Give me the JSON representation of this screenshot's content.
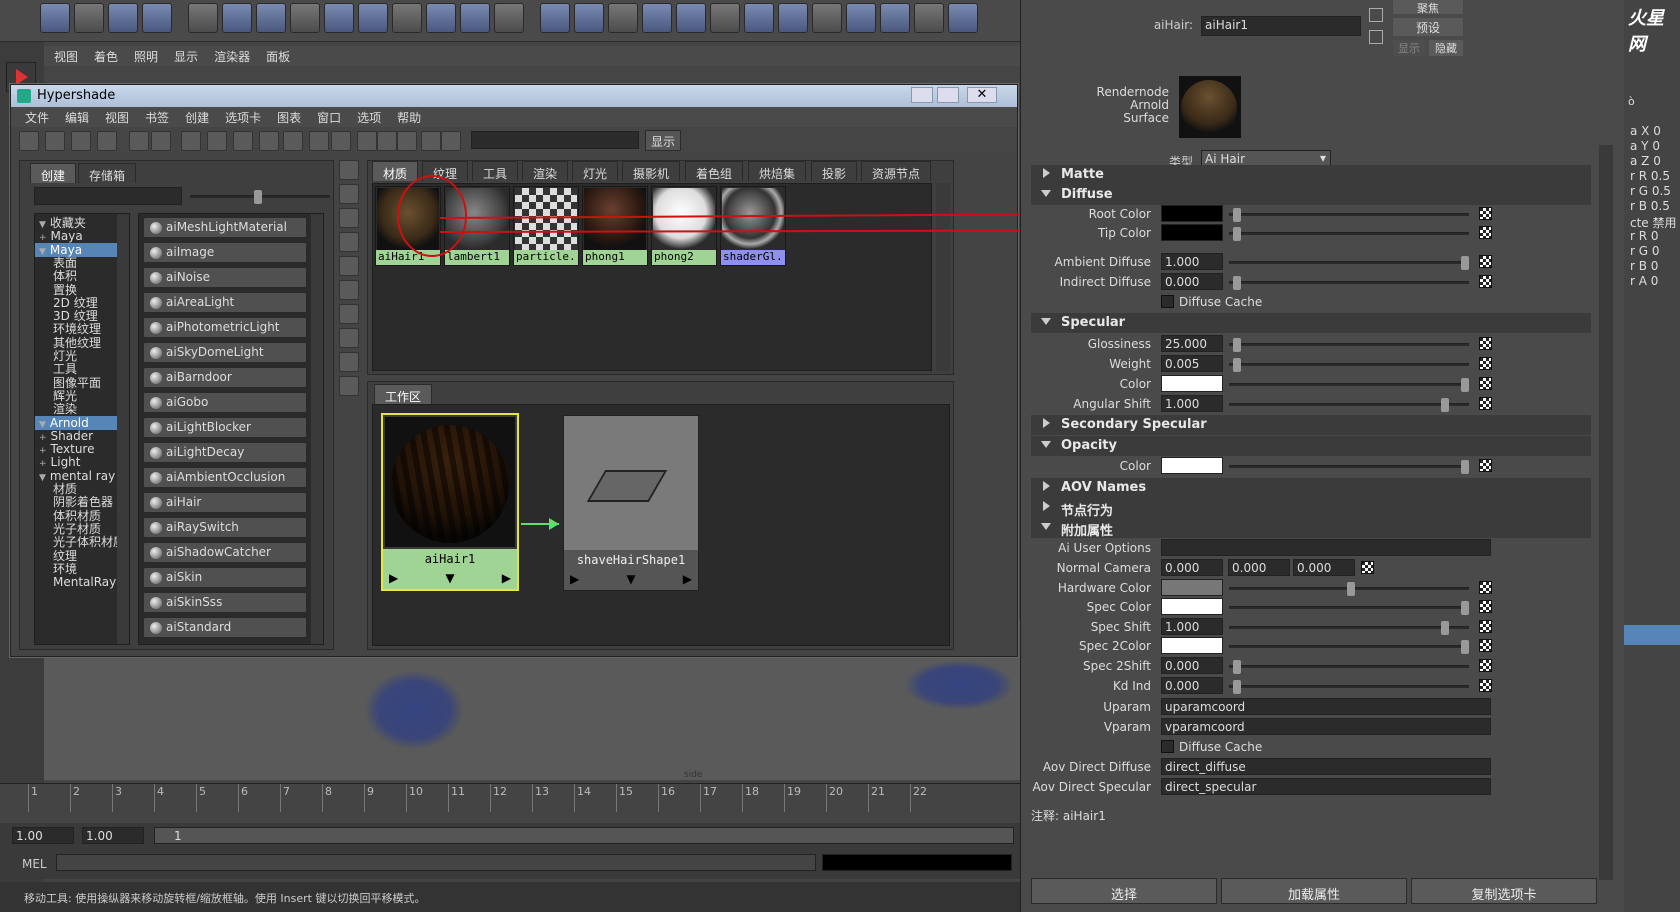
{
  "viewport_menu": [
    "视图",
    "着色",
    "照明",
    "显示",
    "渲染器",
    "面板"
  ],
  "hypershade": {
    "title": "Hypershade",
    "menu": [
      "文件",
      "编辑",
      "视图",
      "书签",
      "创建",
      "选项卡",
      "图表",
      "窗口",
      "选项",
      "帮助"
    ],
    "show_button": "显示",
    "left_tabs": [
      "创建",
      "存储箱"
    ],
    "tree": [
      {
        "label": "收藏夹",
        "indent": 0,
        "exp": "▼"
      },
      {
        "label": "Maya",
        "indent": 1,
        "exp": "+"
      },
      {
        "label": "Maya",
        "indent": 0,
        "exp": "▼",
        "sel": true
      },
      {
        "label": "表面",
        "indent": 2
      },
      {
        "label": "体积",
        "indent": 2
      },
      {
        "label": "置换",
        "indent": 2
      },
      {
        "label": "2D 纹理",
        "indent": 2
      },
      {
        "label": "3D 纹理",
        "indent": 2
      },
      {
        "label": "环境纹理",
        "indent": 2
      },
      {
        "label": "其他纹理",
        "indent": 2
      },
      {
        "label": "灯光",
        "indent": 2
      },
      {
        "label": "工具",
        "indent": 2
      },
      {
        "label": "图像平面",
        "indent": 2
      },
      {
        "label": "辉光",
        "indent": 2
      },
      {
        "label": "渲染",
        "indent": 2
      },
      {
        "label": "Arnold",
        "indent": 0,
        "exp": "▼",
        "sel": true
      },
      {
        "label": "Shader",
        "indent": 1,
        "exp": "+"
      },
      {
        "label": "Texture",
        "indent": 1,
        "exp": "+"
      },
      {
        "label": "Light",
        "indent": 1,
        "exp": "+"
      },
      {
        "label": "mental ray",
        "indent": 0,
        "exp": "▼"
      },
      {
        "label": "材质",
        "indent": 2
      },
      {
        "label": "阴影着色器",
        "indent": 2
      },
      {
        "label": "体积材质",
        "indent": 2
      },
      {
        "label": "光子材质",
        "indent": 2
      },
      {
        "label": "光子体积材质",
        "indent": 2
      },
      {
        "label": "纹理",
        "indent": 2
      },
      {
        "label": "环境",
        "indent": 2
      },
      {
        "label": "MentalRay ...",
        "indent": 2
      }
    ],
    "nodes": [
      "aiMeshLightMaterial",
      "aiImage",
      "aiNoise",
      "aiAreaLight",
      "aiPhotometricLight",
      "aiSkyDomeLight",
      "aiBarndoor",
      "aiGobo",
      "aiLightBlocker",
      "aiLightDecay",
      "aiAmbientOcclusion",
      "aiHair",
      "aiRaySwitch",
      "aiShadowCatcher",
      "aiSkin",
      "aiSkinSss",
      "aiStandard"
    ],
    "top_tabs": [
      "材质",
      "纹理",
      "工具",
      "渲染",
      "灯光",
      "摄影机",
      "着色组",
      "烘焙集",
      "投影",
      "资源节点"
    ],
    "swatches": [
      {
        "label": "aiHair1",
        "kind": "hair",
        "color": "#9fd494"
      },
      {
        "label": "lambert1",
        "kind": "grey",
        "color": "#9fd494"
      },
      {
        "label": "particle...",
        "kind": "checker",
        "color": "#9fd494"
      },
      {
        "label": "phong1",
        "kind": "dark",
        "color": "#9fd494"
      },
      {
        "label": "phong2",
        "kind": "white",
        "color": "#9fd494"
      },
      {
        "label": "shaderGl...",
        "kind": "glass",
        "color": "#8f8ff0"
      }
    ],
    "work_tab": "工作区",
    "work_nodes": {
      "left": "aiHair1",
      "right": "shaveHairShape1"
    }
  },
  "attribute_editor": {
    "node_label": "aiHair:",
    "node_name": "aiHair1",
    "btn_focus": "聚焦",
    "btn_preset": "预设",
    "btn_show": "显示",
    "btn_hide": "隐藏",
    "rendernode_label": "Rendernode Arnold Surface",
    "type_label": "类型",
    "type_value": "Ai Hair",
    "sections": {
      "matte": "Matte",
      "diffuse": "Diffuse",
      "specular": "Specular",
      "secondary": "Secondary Specular",
      "opacity": "Opacity",
      "aov": "AOV Names",
      "node_behavior": "节点行为",
      "extra": "附加属性"
    },
    "attrs": {
      "root_color": "Root Color",
      "tip_color": "Tip Color",
      "ambient_diffuse": "Ambient Diffuse",
      "ambient_diffuse_v": "1.000",
      "indirect_diffuse": "Indirect Diffuse",
      "indirect_diffuse_v": "0.000",
      "diffuse_cache": "Diffuse Cache",
      "glossiness": "Glossiness",
      "glossiness_v": "25.000",
      "weight": "Weight",
      "weight_v": "0.005",
      "color": "Color",
      "angular_shift": "Angular Shift",
      "angular_shift_v": "1.000",
      "op_color": "Color",
      "ai_user_options": "Ai User Options",
      "normal_camera": "Normal Camera",
      "nc_x": "0.000",
      "nc_y": "0.000",
      "nc_z": "0.000",
      "hardware_color": "Hardware Color",
      "spec_color": "Spec Color",
      "spec_shift": "Spec Shift",
      "spec_shift_v": "1.000",
      "spec2color": "Spec 2Color",
      "spec2shift": "Spec 2Shift",
      "spec2shift_v": "0.000",
      "kd_ind": "Kd Ind",
      "kd_ind_v": "0.000",
      "uparam": "Uparam",
      "uparam_v": "uparamcoord",
      "vparam": "Vparam",
      "vparam_v": "vparamcoord",
      "diffuse_cache2": "Diffuse Cache",
      "aov_direct_diffuse": "Aov Direct Diffuse",
      "aov_direct_diffuse_v": "direct_diffuse",
      "aov_direct_specular": "Aov Direct Specular",
      "aov_direct_specular_v": "direct_specular"
    },
    "note": "注释: aiHair1",
    "bottom_buttons": [
      "选择",
      "加载属性",
      "复制选项卡"
    ]
  },
  "channel_box": [
    "a X 0",
    "a Y 0",
    "a Z 0",
    "r R 0.5",
    "r G 0.5",
    "r B 0.5",
    "cte 禁用",
    "r R 0",
    "r G 0",
    "r B 0",
    "r A 0"
  ],
  "right_top_label": "ò",
  "watermark": "火星网",
  "timeline": [
    "1",
    "2",
    "3",
    "4",
    "5",
    "6",
    "7",
    "8",
    "9",
    "10",
    "11",
    "12",
    "13",
    "14",
    "15",
    "16",
    "17",
    "18",
    "19",
    "20",
    "21",
    "22"
  ],
  "range": {
    "start": "1.00",
    "cur": "1.00",
    "frame": "1"
  },
  "mel": "MEL",
  "help": "移动工具: 使用操纵器来移动旋转框/缩放框轴。使用 Insert 键以切换回平移模式。",
  "viewport_label": "side",
  "colors": {
    "accent": "#5685b8",
    "swatch_green": "#9fd494",
    "arrow": "#cc1111"
  }
}
